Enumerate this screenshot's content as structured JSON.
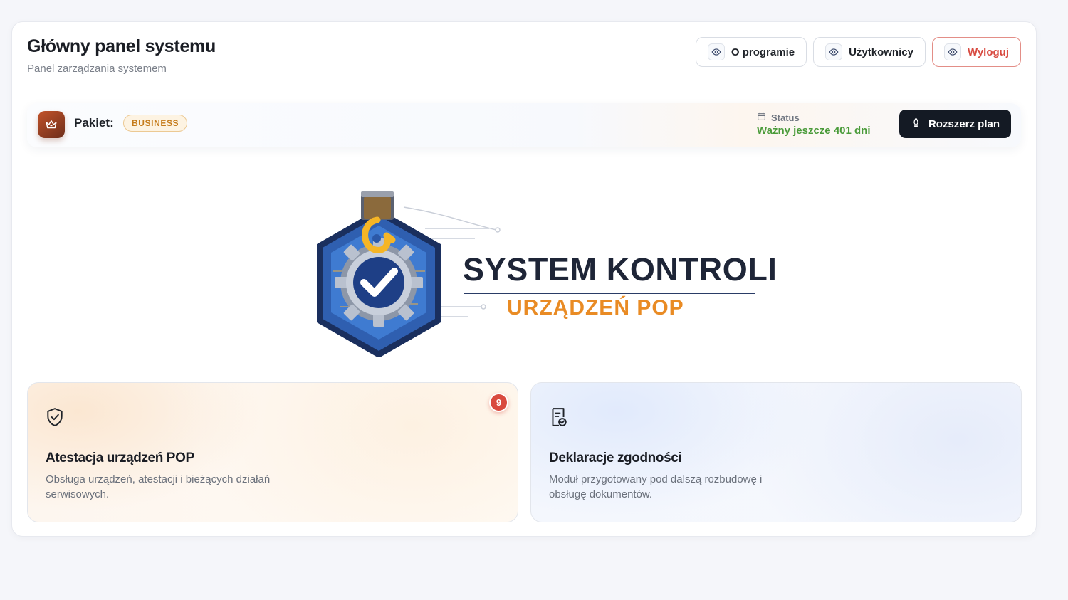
{
  "header": {
    "title": "Główny panel systemu",
    "subtitle": "Panel zarządzania systemem"
  },
  "top_actions": {
    "about_label": "O programie",
    "users_label": "Użytkownicy",
    "logout_label": "Wyloguj",
    "icon": "eye-icon"
  },
  "plan": {
    "label": "Pakiet:",
    "badge": "BUSINESS",
    "status_label": "Status",
    "status_value": "Ważny jeszcze 401 dni",
    "extend_label": "Rozszerz plan"
  },
  "logo": {
    "title": "SYSTEM KONTROLI",
    "subtitle": "URZĄDZEŃ POP"
  },
  "cards": [
    {
      "title": "Atestacja urządzeń POP",
      "description": "Obsługa urządzeń, atestacji i bieżących działań serwisowych.",
      "badge": "9",
      "icon": "shield-check-icon"
    },
    {
      "title": "Deklaracje zgodności",
      "description": "Moduł przygotowany pod dalszą rozbudowę i obsługę dokumentów.",
      "icon": "document-check-icon"
    }
  ],
  "colors": {
    "accent_dark": "#141a24",
    "status_green": "#4a9b3a",
    "logout_red": "#d84b41",
    "badge_orange": "#c57b1a",
    "logo_orange": "#e98b24",
    "logo_navy": "#1e2537"
  }
}
